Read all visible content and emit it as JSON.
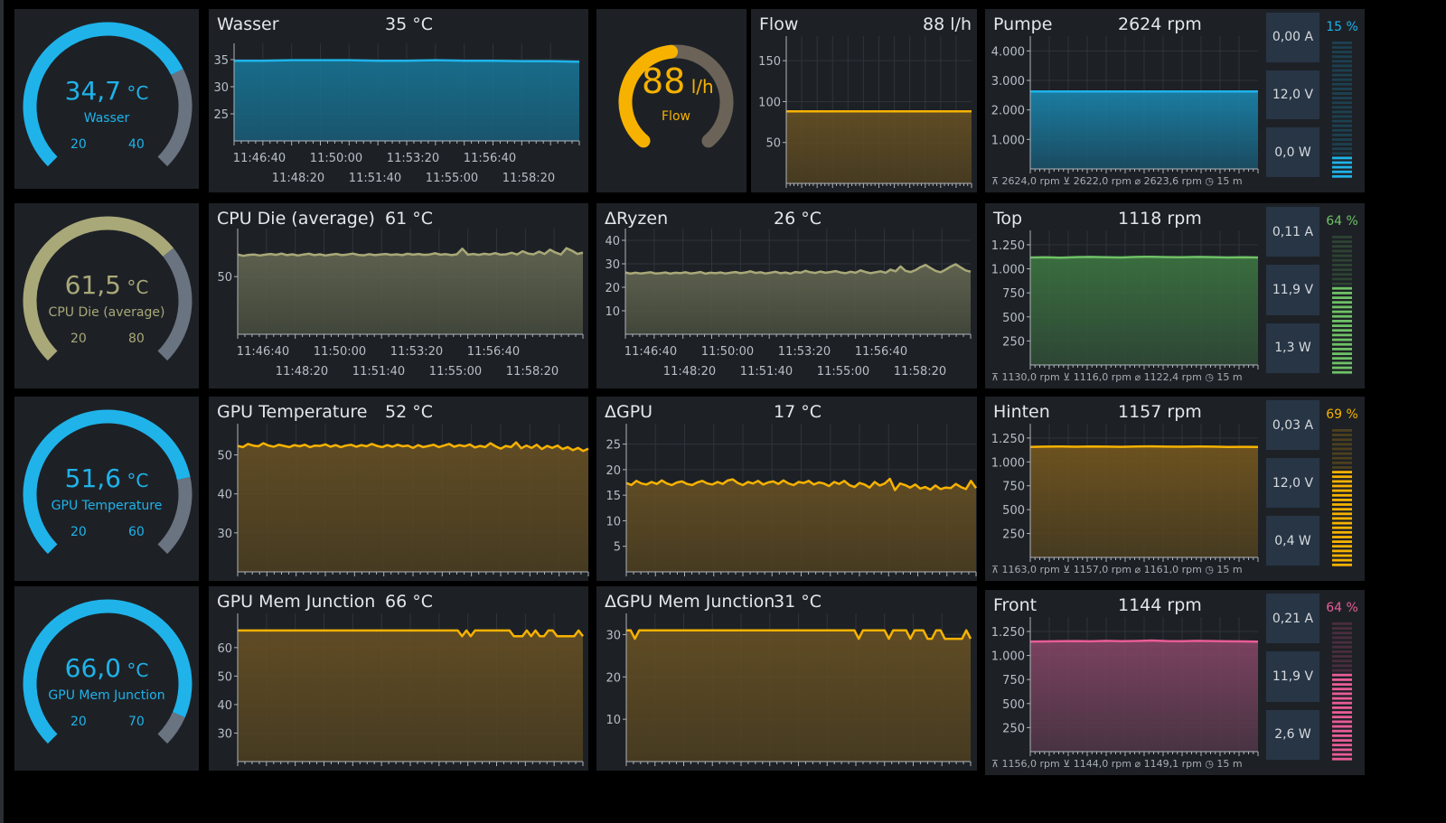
{
  "colors": {
    "blue": "#1fb3ea",
    "khaki": "#a9a878",
    "orange": "#f7b200",
    "green": "#6fc166",
    "pink": "#e85c97",
    "gray": "#6a7380",
    "flow_track": "#6b6357",
    "panel": "#1d2126",
    "box": "#273545"
  },
  "gauges": [
    {
      "id": "wasser",
      "value": "34,7",
      "unit": "°C",
      "label": "Wasser",
      "min": "20",
      "max": "40",
      "fraction": 0.735,
      "color": "#1fb3ea"
    },
    {
      "id": "cpu",
      "value": "61,5",
      "unit": "°C",
      "label": "CPU Die (average)",
      "min": "20",
      "max": "80",
      "fraction": 0.69,
      "color": "#a9a878"
    },
    {
      "id": "gpu",
      "value": "51,6",
      "unit": "°C",
      "label": "GPU Temperature",
      "min": "20",
      "max": "60",
      "fraction": 0.79,
      "color": "#1fb3ea"
    },
    {
      "id": "gpumem",
      "value": "66,0",
      "unit": "°C",
      "label": "GPU Mem Junction",
      "min": "20",
      "max": "70",
      "fraction": 0.92,
      "color": "#1fb3ea"
    }
  ],
  "flow_gauge": {
    "value": "88",
    "unit": "l/h",
    "label": "Flow",
    "fraction": 0.48
  },
  "temp_charts": [
    {
      "id": "wasser",
      "title": "Wasser",
      "value": "35 °C"
    },
    {
      "id": "cpu",
      "title": "CPU Die (average)",
      "value": "61 °C"
    },
    {
      "id": "ryzen",
      "title": "ΔRyzen",
      "value": "26 °C"
    },
    {
      "id": "gputemp",
      "title": "GPU Temperature",
      "value": "52 °C"
    },
    {
      "id": "dgpu",
      "title": "ΔGPU",
      "value": "17 °C"
    },
    {
      "id": "gpumem",
      "title": "GPU Mem Junction",
      "value": "66 °C"
    },
    {
      "id": "dgpumem",
      "title": "ΔGPU Mem Junction",
      "value": "31 °C"
    },
    {
      "id": "flow",
      "title": "Flow",
      "value": "88 l/h"
    }
  ],
  "time_ticks_top": [
    "11:46:40",
    "11:50:00",
    "11:53:20",
    "11:56:40"
  ],
  "time_ticks_bottom": [
    "11:48:20",
    "11:51:40",
    "11:55:00",
    "11:58:20"
  ],
  "fans": [
    {
      "id": "pumpe",
      "title": "Pumpe",
      "rpm": "2624 rpm",
      "amp": "0,00 A",
      "volt": "12,0 V",
      "watt": "0,0 W",
      "pct": "15 %",
      "pct_value": 15,
      "color": "#1fb3ea",
      "legend": {
        "max": "2624,0 rpm",
        "min": "2622,0 rpm",
        "avg": "2623,6 rpm",
        "span": "15 m"
      },
      "ticks": [
        "4.000",
        "3.000",
        "2.000",
        "1.000"
      ]
    },
    {
      "id": "top",
      "title": "Top",
      "rpm": "1118 rpm",
      "amp": "0,11 A",
      "volt": "11,9 V",
      "watt": "1,3 W",
      "pct": "64 %",
      "pct_value": 64,
      "color": "#6fc166",
      "legend": {
        "max": "1130,0 rpm",
        "min": "1116,0 rpm",
        "avg": "1122,4 rpm",
        "span": "15 m"
      },
      "ticks": [
        "1.250",
        "1.000",
        "750",
        "500",
        "250"
      ]
    },
    {
      "id": "hinten",
      "title": "Hinten",
      "rpm": "1157 rpm",
      "amp": "0,03 A",
      "volt": "12,0 V",
      "watt": "0,4 W",
      "pct": "69 %",
      "pct_value": 69,
      "color": "#f7b200",
      "legend": {
        "max": "1163,0 rpm",
        "min": "1157,0 rpm",
        "avg": "1161,0 rpm",
        "span": "15 m"
      },
      "ticks": [
        "1.250",
        "1.000",
        "750",
        "500",
        "250"
      ]
    },
    {
      "id": "front",
      "title": "Front",
      "rpm": "1144 rpm",
      "amp": "0,21 A",
      "volt": "11,9 V",
      "watt": "2,6 W",
      "pct": "64 %",
      "pct_value": 64,
      "color": "#e85c97",
      "legend": {
        "max": "1156,0 rpm",
        "min": "1144,0 rpm",
        "avg": "1149,1 rpm",
        "span": "15 m"
      },
      "ticks": [
        "1.250",
        "1.000",
        "750",
        "500",
        "250"
      ]
    }
  ],
  "chart_data": [
    {
      "type": "area",
      "title": "Wasser",
      "ylim": [
        20,
        38
      ],
      "yticks": [
        25,
        30,
        35
      ],
      "series": [
        {
          "values": [
            34.8,
            34.8,
            34.9,
            34.9,
            34.9,
            34.8,
            34.8,
            34.9,
            34.8,
            34.8,
            34.7,
            34.7,
            34.6
          ]
        }
      ]
    },
    {
      "type": "area",
      "title": "Flow",
      "ylim": [
        0,
        180
      ],
      "yticks": [
        50,
        100,
        150
      ],
      "series": [
        {
          "values": [
            88,
            88,
            88,
            88,
            88,
            88,
            88,
            88,
            88,
            88
          ]
        }
      ]
    },
    {
      "type": "area",
      "title": "CPU Die (average)",
      "ylim": [
        20,
        75
      ],
      "yticks": [
        50
      ],
      "series": [
        {
          "values": [
            61.5,
            60.8,
            61.3,
            61.5,
            61.0,
            61.4,
            61.8,
            61.3,
            62.0,
            61.2,
            61.6,
            61.0,
            61.5,
            61.9,
            61.2,
            61.6,
            61.0,
            61.4,
            61.8,
            61.2,
            61.5,
            62.0,
            61.3,
            61.1,
            61.7,
            61.2,
            61.5,
            61.8,
            61.3,
            61.6,
            61.2,
            61.9,
            61.4,
            61.8,
            61.3,
            61.5,
            62.1,
            61.4,
            61.7,
            61.2,
            61.6,
            64.5,
            61.4,
            61.8,
            61.3,
            61.9,
            61.5,
            62.2,
            61.4,
            61.6,
            62.4,
            61.5,
            63.2,
            62.0,
            61.6,
            63.0,
            61.8,
            64.0,
            62.5,
            61.5,
            64.8,
            63.5,
            61.8,
            62.5
          ]
        }
      ]
    },
    {
      "type": "area",
      "title": "ΔRyzen",
      "ylim": [
        0,
        45
      ],
      "yticks": [
        10,
        20,
        30,
        40
      ],
      "series": [
        {
          "values": [
            26.3,
            25.8,
            26.2,
            25.9,
            26.1,
            26.4,
            25.9,
            26.0,
            26.3,
            25.8,
            26.2,
            26.0,
            26.4,
            25.9,
            26.1,
            26.5,
            25.8,
            26.2,
            26.0,
            26.3,
            25.9,
            26.2,
            26.5,
            26.0,
            26.3,
            26.8,
            26.1,
            26.4,
            25.9,
            26.2,
            26.6,
            26.0,
            26.3,
            25.8,
            26.5,
            26.2,
            27.0,
            26.4,
            26.1,
            26.7,
            26.2,
            26.5,
            26.9,
            26.3,
            26.0,
            26.6,
            26.2,
            27.2,
            26.5,
            26.0,
            26.4,
            26.8,
            26.2,
            27.5,
            26.8,
            28.9,
            27.0,
            26.5,
            27.3,
            28.6,
            29.5,
            28.2,
            27.0,
            26.4,
            27.5,
            28.8,
            29.8,
            28.5,
            27.2,
            26.6
          ]
        }
      ]
    },
    {
      "type": "area",
      "title": "GPU Temperature",
      "ylim": [
        20,
        58
      ],
      "yticks": [
        30,
        40,
        50
      ],
      "series": [
        {
          "values": [
            52.3,
            52.0,
            52.8,
            52.4,
            52.2,
            53.0,
            52.4,
            52.1,
            52.6,
            52.3,
            52.0,
            52.5,
            52.2,
            52.6,
            52.0,
            52.4,
            52.3,
            52.7,
            52.1,
            52.5,
            52.0,
            52.4,
            52.6,
            52.1,
            52.5,
            52.2,
            52.8,
            52.3,
            52.0,
            52.5,
            52.1,
            52.6,
            52.2,
            52.4,
            51.8,
            52.5,
            52.0,
            52.3,
            52.6,
            52.0,
            52.4,
            52.8,
            52.1,
            52.5,
            52.2,
            52.7,
            51.9,
            52.3,
            52.0,
            53.0,
            52.2,
            51.6,
            52.3,
            52.0,
            53.2,
            51.7,
            52.4,
            51.8,
            52.6,
            51.5,
            52.3,
            51.8,
            52.4,
            51.5,
            52.0,
            51.2,
            51.8,
            51.0,
            51.6
          ]
        }
      ]
    },
    {
      "type": "area",
      "title": "ΔGPU",
      "ylim": [
        0,
        29
      ],
      "yticks": [
        5,
        10,
        15,
        20,
        25
      ],
      "series": [
        {
          "values": [
            17.4,
            17.0,
            17.8,
            17.3,
            17.1,
            17.6,
            17.2,
            17.9,
            17.3,
            17.0,
            17.5,
            17.7,
            17.2,
            17.0,
            17.5,
            17.8,
            17.3,
            17.1,
            17.6,
            17.2,
            17.9,
            18.1,
            17.4,
            17.0,
            17.6,
            17.3,
            17.8,
            17.1,
            17.5,
            17.7,
            17.2,
            17.9,
            17.3,
            17.0,
            17.6,
            17.4,
            17.8,
            17.1,
            17.5,
            17.3,
            16.8,
            17.6,
            17.2,
            17.8,
            17.0,
            16.6,
            17.4,
            17.1,
            16.5,
            17.6,
            16.9,
            17.3,
            18.2,
            16.0,
            17.3,
            17.0,
            16.5,
            17.1,
            16.3,
            16.6,
            16.1,
            16.9,
            16.2,
            16.5,
            16.4,
            17.2,
            16.6,
            16.2,
            17.8,
            16.4
          ]
        }
      ]
    },
    {
      "type": "area",
      "title": "GPU Mem Junction",
      "ylim": [
        20,
        72
      ],
      "yticks": [
        30,
        40,
        50,
        60
      ],
      "series": [
        {
          "values": [
            66,
            66,
            66,
            66,
            66,
            66,
            66,
            66,
            66,
            66,
            66,
            66,
            66,
            66,
            66,
            66,
            66,
            66,
            66,
            66,
            66,
            66,
            66,
            66,
            66,
            66,
            66,
            66,
            66,
            66,
            66,
            66,
            66,
            66,
            66,
            66,
            66,
            66,
            66,
            66,
            66,
            66,
            66,
            66,
            66,
            66,
            66,
            66,
            66,
            66,
            66,
            66,
            64,
            66,
            64,
            66,
            66,
            66,
            66,
            66,
            66,
            66,
            66,
            66,
            64,
            64,
            64,
            66,
            64,
            66,
            64,
            64,
            66,
            66,
            64,
            64,
            64,
            64,
            64,
            66,
            64
          ]
        }
      ]
    },
    {
      "type": "area",
      "title": "ΔGPU Mem Junction",
      "ylim": [
        0,
        35
      ],
      "yticks": [
        10,
        20,
        30
      ],
      "series": [
        {
          "values": [
            31,
            31,
            29,
            31,
            31,
            31,
            31,
            31,
            31,
            31,
            31,
            31,
            31,
            31,
            31,
            31,
            31,
            31,
            31,
            31,
            31,
            31,
            31,
            31,
            31,
            31,
            31,
            31,
            31,
            31,
            31,
            31,
            31,
            31,
            31,
            31,
            31,
            31,
            31,
            31,
            31,
            31,
            31,
            31,
            31,
            31,
            31,
            31,
            31,
            31,
            31,
            31,
            31,
            31,
            29,
            31,
            31,
            31,
            31,
            31,
            31,
            29,
            31,
            31,
            31,
            31,
            29,
            31,
            31,
            31,
            29,
            29,
            31,
            31,
            29,
            29,
            29,
            29,
            29,
            31,
            29
          ]
        }
      ]
    },
    {
      "type": "area",
      "title": "Pumpe",
      "ylim": [
        0,
        4500
      ],
      "yticks": [
        1000,
        2000,
        3000,
        4000
      ],
      "series": [
        {
          "values": [
            2624,
            2624,
            2623,
            2624,
            2624,
            2624,
            2623,
            2624,
            2624,
            2624
          ]
        }
      ]
    },
    {
      "type": "area",
      "title": "Top",
      "ylim": [
        0,
        1400
      ],
      "yticks": [
        250,
        500,
        750,
        1000,
        1250
      ],
      "series": [
        {
          "values": [
            1118,
            1120,
            1116,
            1122,
            1124,
            1120,
            1118,
            1124,
            1126,
            1122,
            1120,
            1124,
            1122,
            1118,
            1120,
            1118
          ]
        }
      ]
    },
    {
      "type": "area",
      "title": "Hinten",
      "ylim": [
        0,
        1400
      ],
      "yticks": [
        250,
        500,
        750,
        1000,
        1250
      ],
      "series": [
        {
          "values": [
            1157,
            1160,
            1161,
            1159,
            1162,
            1160,
            1158,
            1161,
            1163,
            1160,
            1159,
            1161,
            1160,
            1157,
            1158,
            1157
          ]
        }
      ]
    },
    {
      "type": "area",
      "title": "Front",
      "ylim": [
        0,
        1400
      ],
      "yticks": [
        250,
        500,
        750,
        1000,
        1250
      ],
      "series": [
        {
          "values": [
            1144,
            1146,
            1148,
            1150,
            1147,
            1152,
            1149,
            1151,
            1156,
            1150,
            1148,
            1152,
            1150,
            1147,
            1146,
            1144
          ]
        }
      ]
    }
  ]
}
